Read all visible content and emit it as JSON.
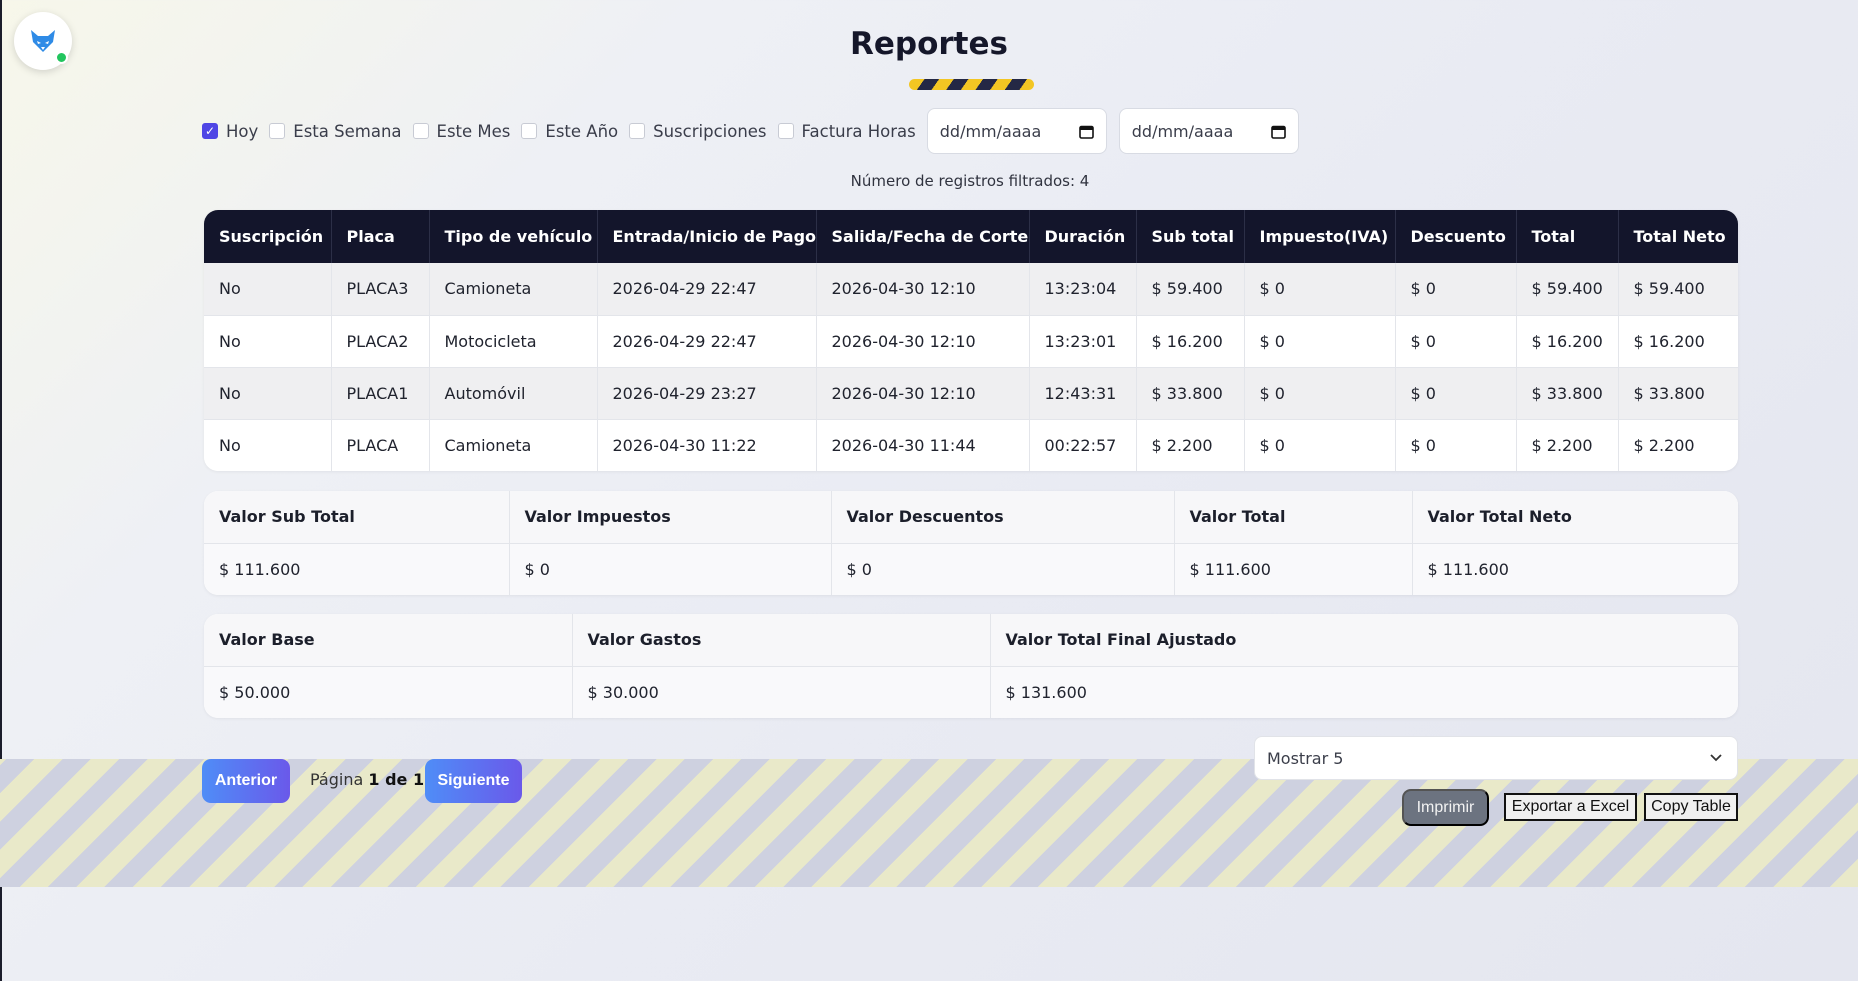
{
  "page": {
    "title": "Reportes"
  },
  "filters": {
    "options": [
      {
        "label": "Hoy",
        "checked": true
      },
      {
        "label": "Esta Semana",
        "checked": false
      },
      {
        "label": "Este Mes",
        "checked": false
      },
      {
        "label": "Este Año",
        "checked": false
      },
      {
        "label": "Suscripciones",
        "checked": false
      },
      {
        "label": "Factura Horas",
        "checked": false
      }
    ],
    "date_from_placeholder": "dd/mm/aaaa",
    "date_to_placeholder": "dd/mm/aaaa"
  },
  "record_count": "Número de registros filtrados: 4",
  "main_table": {
    "columns": [
      "Suscripción",
      "Placa",
      "Tipo de vehículo",
      "Entrada/Inicio de Pago",
      "Salida/Fecha de Corte",
      "Duración",
      "Sub total",
      "Impuesto(IVA)",
      "Descuento",
      "Total",
      "Total Neto"
    ],
    "rows": [
      [
        "No",
        "PLACA3",
        "Camioneta",
        "2026-04-29 22:47",
        "2026-04-30 12:10",
        "13:23:04",
        "$ 59.400",
        "$ 0",
        "$ 0",
        "$ 59.400",
        "$ 59.400"
      ],
      [
        "No",
        "PLACA2",
        "Motocicleta",
        "2026-04-29 22:47",
        "2026-04-30 12:10",
        "13:23:01",
        "$ 16.200",
        "$ 0",
        "$ 0",
        "$ 16.200",
        "$ 16.200"
      ],
      [
        "No",
        "PLACA1",
        "Automóvil",
        "2026-04-29 23:27",
        "2026-04-30 12:10",
        "12:43:31",
        "$ 33.800",
        "$ 0",
        "$ 0",
        "$ 33.800",
        "$ 33.800"
      ],
      [
        "No",
        "PLACA",
        "Camioneta",
        "2026-04-30 11:22",
        "2026-04-30 11:44",
        "00:22:57",
        "$ 2.200",
        "$ 0",
        "$ 0",
        "$ 2.200",
        "$ 2.200"
      ]
    ]
  },
  "totals_table": {
    "columns": [
      "Valor Sub Total",
      "Valor Impuestos",
      "Valor Descuentos",
      "Valor Total",
      "Valor Total Neto"
    ],
    "values": [
      "$ 111.600",
      "$ 0",
      "$ 0",
      "$ 111.600",
      "$ 111.600"
    ]
  },
  "adjusted_table": {
    "columns": [
      "Valor Base",
      "Valor Gastos",
      "Valor Total Final Ajustado"
    ],
    "values": [
      "$ 50.000",
      "$ 30.000",
      "$ 131.600"
    ]
  },
  "pagination": {
    "prev_label": "Anterior",
    "next_label": "Siguiente",
    "page_prefix": "Página ",
    "page_value": "1 de 1"
  },
  "page_size": {
    "selected": "Mostrar 5"
  },
  "actions": {
    "print_label": "Imprimir",
    "excel_label": "Exportar a Excel",
    "copy_label": "Copy Table"
  },
  "colors": {
    "accent": "#4f46e5",
    "header_bg": "#13152b",
    "status_online": "#22c55e"
  },
  "icons": {
    "logo": "fox-logo-icon",
    "calendar": "calendar-icon",
    "dropdown": "chevron-down-icon"
  }
}
